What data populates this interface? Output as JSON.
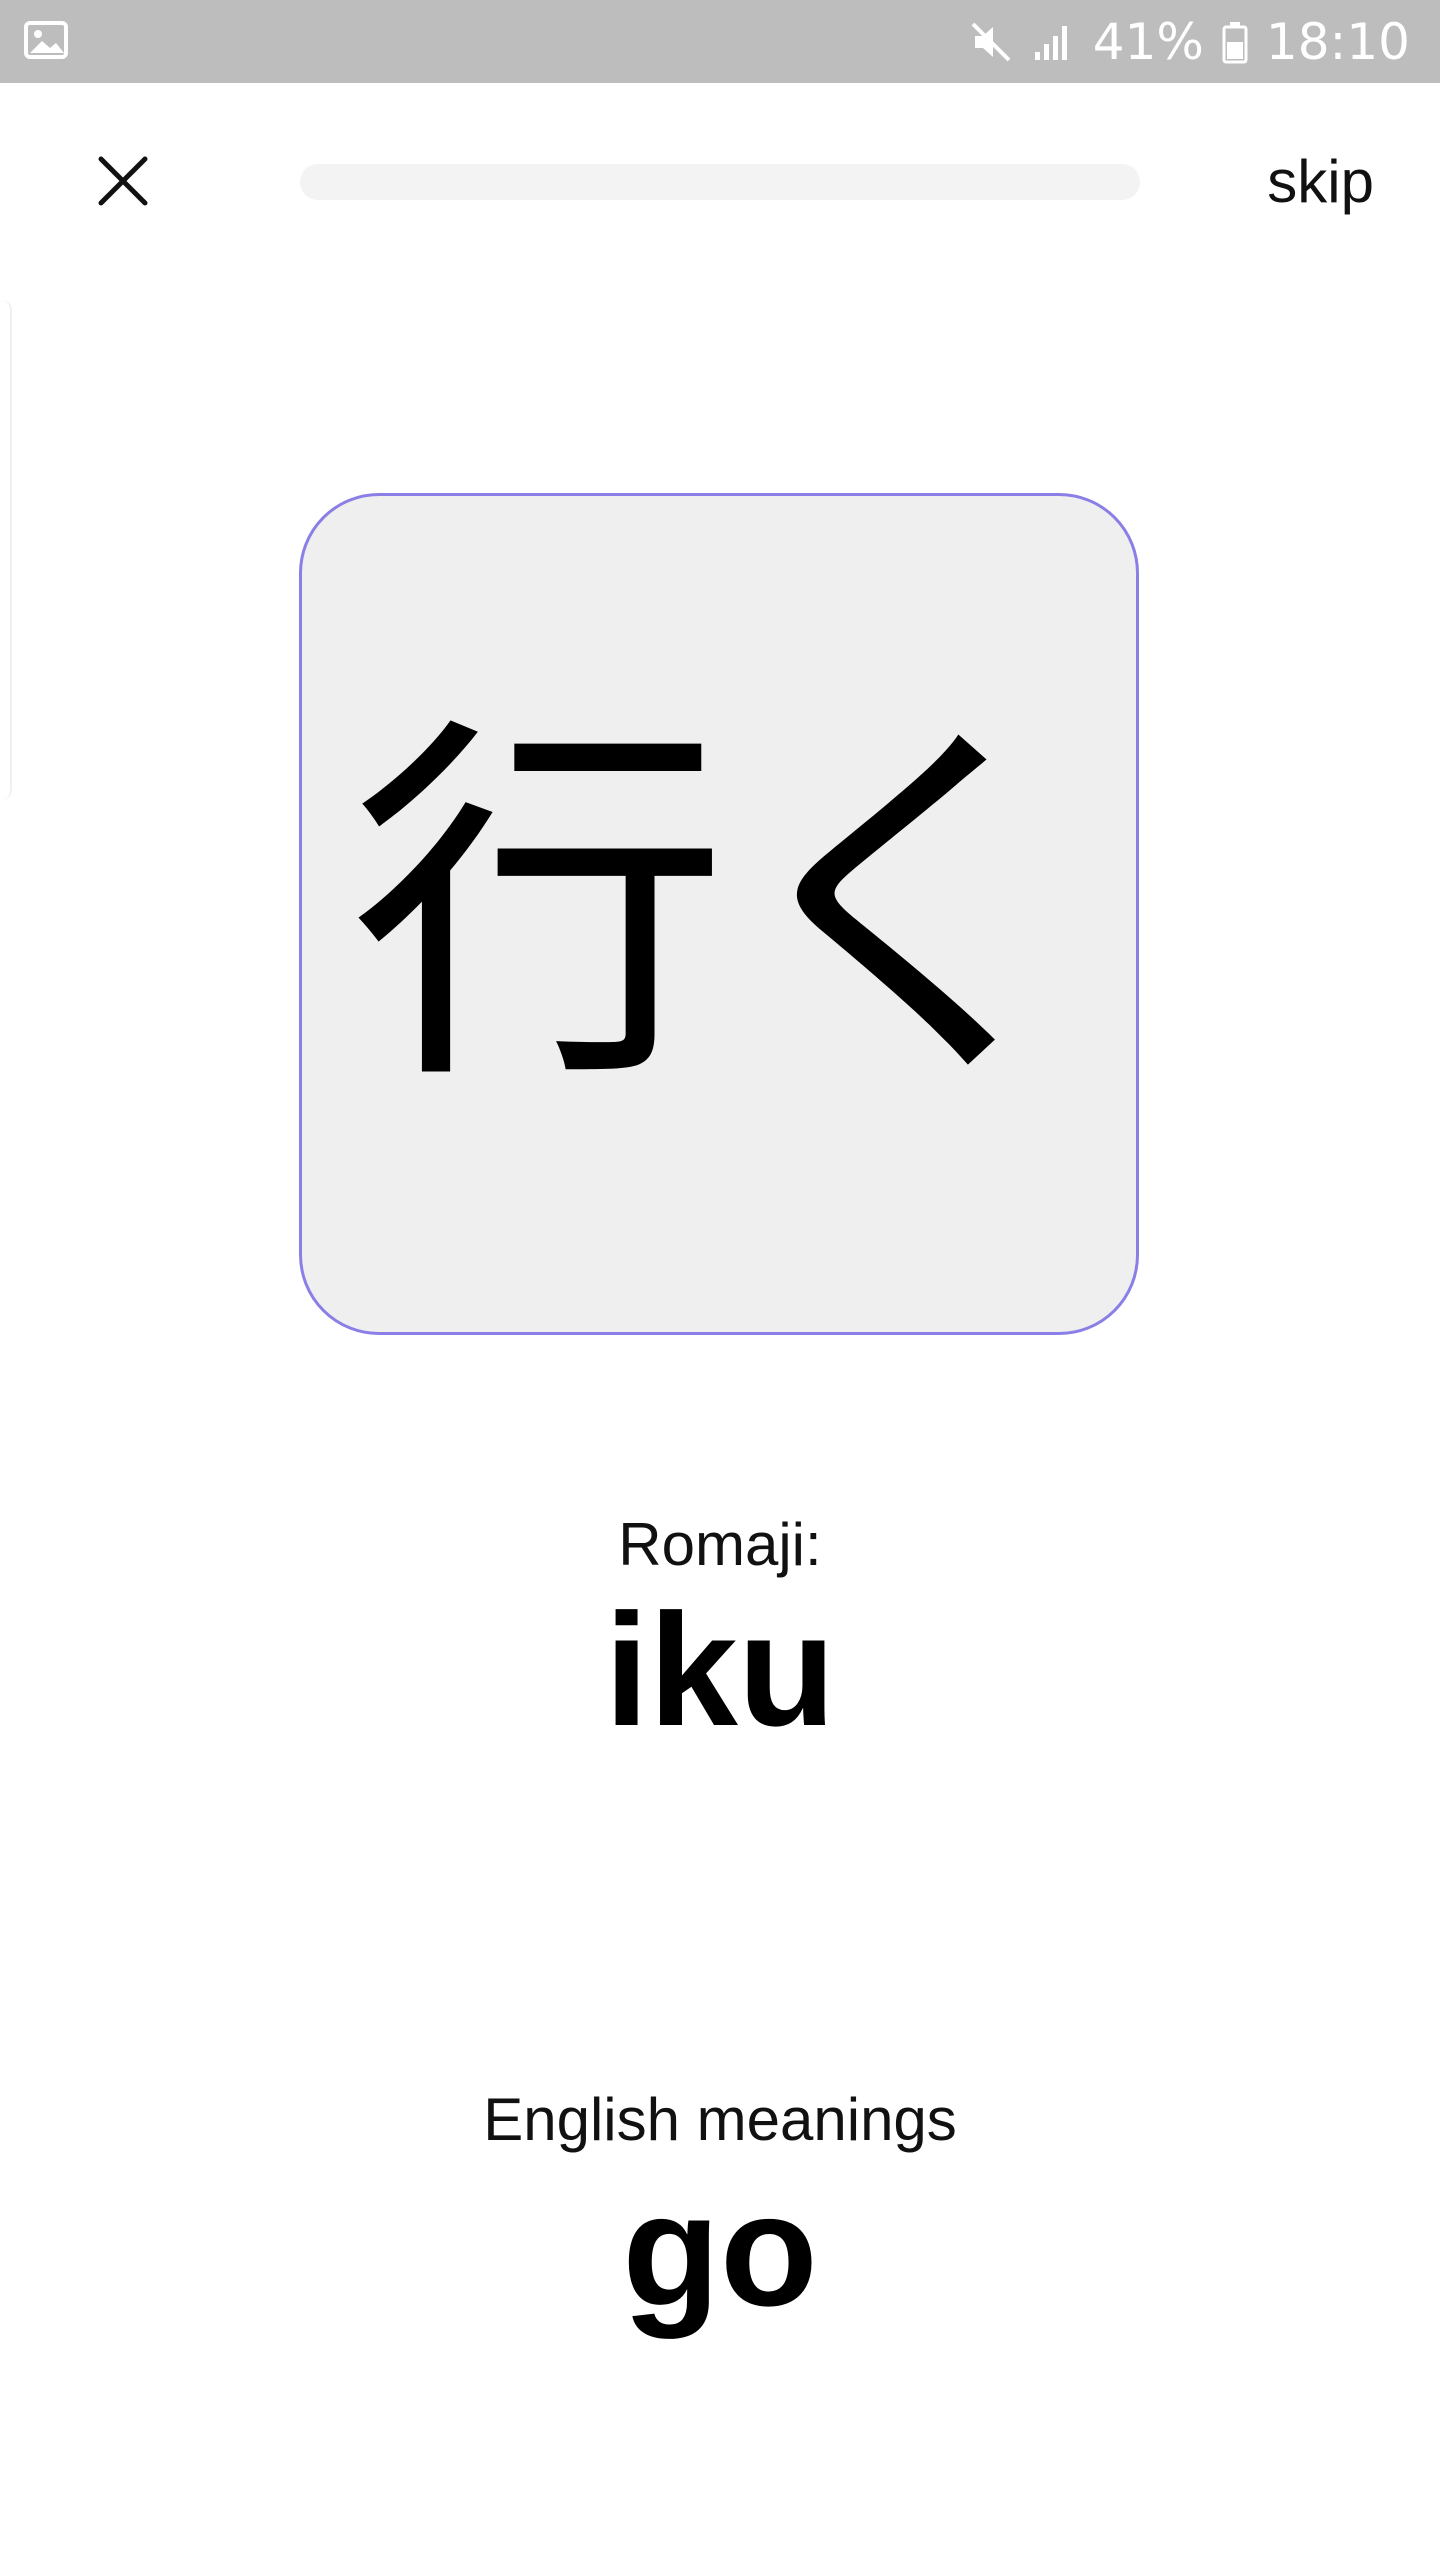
{
  "status_bar": {
    "left_icon": "image-icon",
    "mute_icon": "mute-icon",
    "signal_icon": "signal-icon",
    "battery_percent": "41%",
    "battery_icon": "battery-icon",
    "time": "18:10"
  },
  "toolbar": {
    "close_icon": "close-icon",
    "progress": 0,
    "skip_label": "skip"
  },
  "card": {
    "kanji": "行く"
  },
  "romaji": {
    "label": "Romaji:",
    "value": "iku"
  },
  "meaning": {
    "label": "English meanings",
    "value": "go"
  },
  "colors": {
    "status_bar": "#bdbdbd",
    "card_bg": "#efefef",
    "card_border": "#8a7fe6",
    "progress_track": "#f3f3f3"
  }
}
